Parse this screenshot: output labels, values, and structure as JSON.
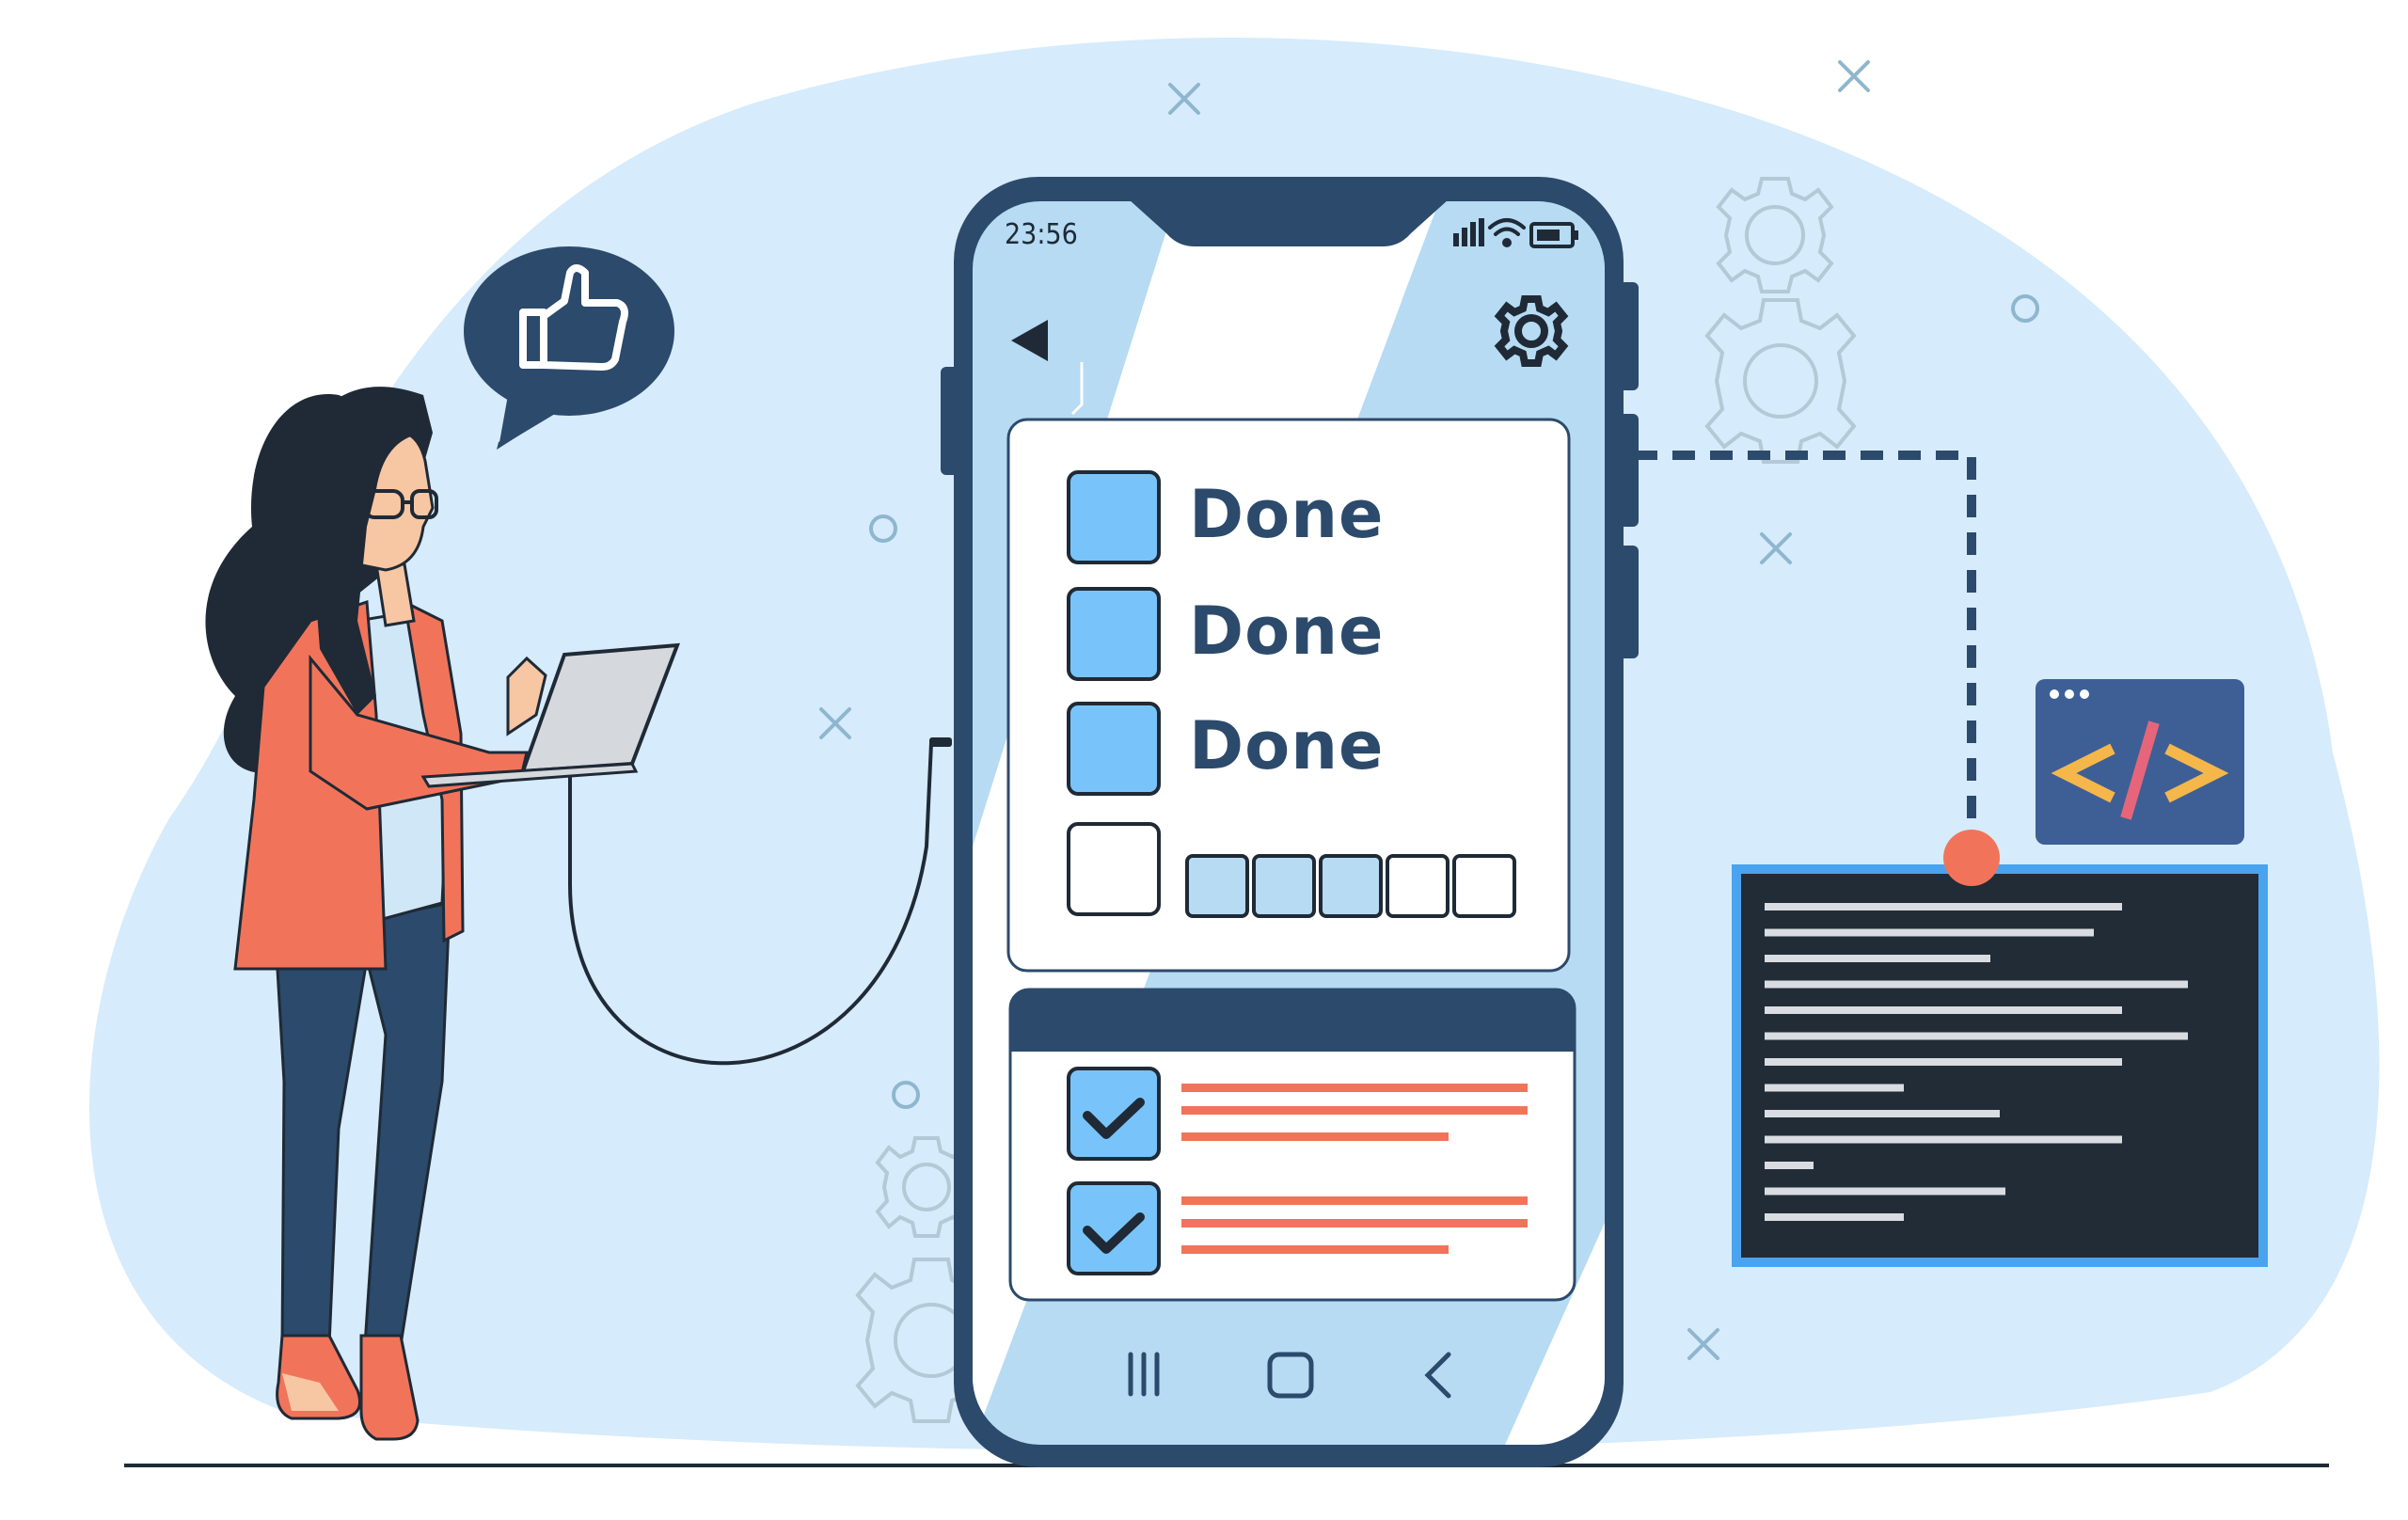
{
  "phone": {
    "status_time": "23:56",
    "tasks": [
      {
        "label": "Done",
        "state": "filled"
      },
      {
        "label": "Done",
        "state": "filled"
      },
      {
        "label": "Done",
        "state": "filled"
      },
      {
        "label": "",
        "state": "empty",
        "progress_filled": 3,
        "progress_total": 5
      }
    ],
    "completed_items": [
      {
        "checked": true
      },
      {
        "checked": true
      }
    ],
    "nav": [
      "recent-apps-icon",
      "home-icon",
      "back-icon"
    ]
  },
  "code_window": {
    "tag_text": "</>",
    "line_count": 13
  },
  "colors": {
    "background_blob": "#d6ebfb",
    "navy": "#2c4a6b",
    "accent_blue": "#78c4fa",
    "light_blue": "#b6dbf3",
    "coral": "#f1745a",
    "terminal_bg": "#222c36",
    "terminal_border": "#4aa3ee",
    "code_tag_bg": "#3d5f96",
    "code_tag_gold": "#f5b74a",
    "code_tag_pink": "#e6657b"
  },
  "icons": [
    "thumbs-up-icon",
    "gear-icon",
    "back-arrow-icon",
    "signal-icon",
    "wifi-icon",
    "battery-icon",
    "checkmark-icon",
    "code-tag-icon"
  ]
}
